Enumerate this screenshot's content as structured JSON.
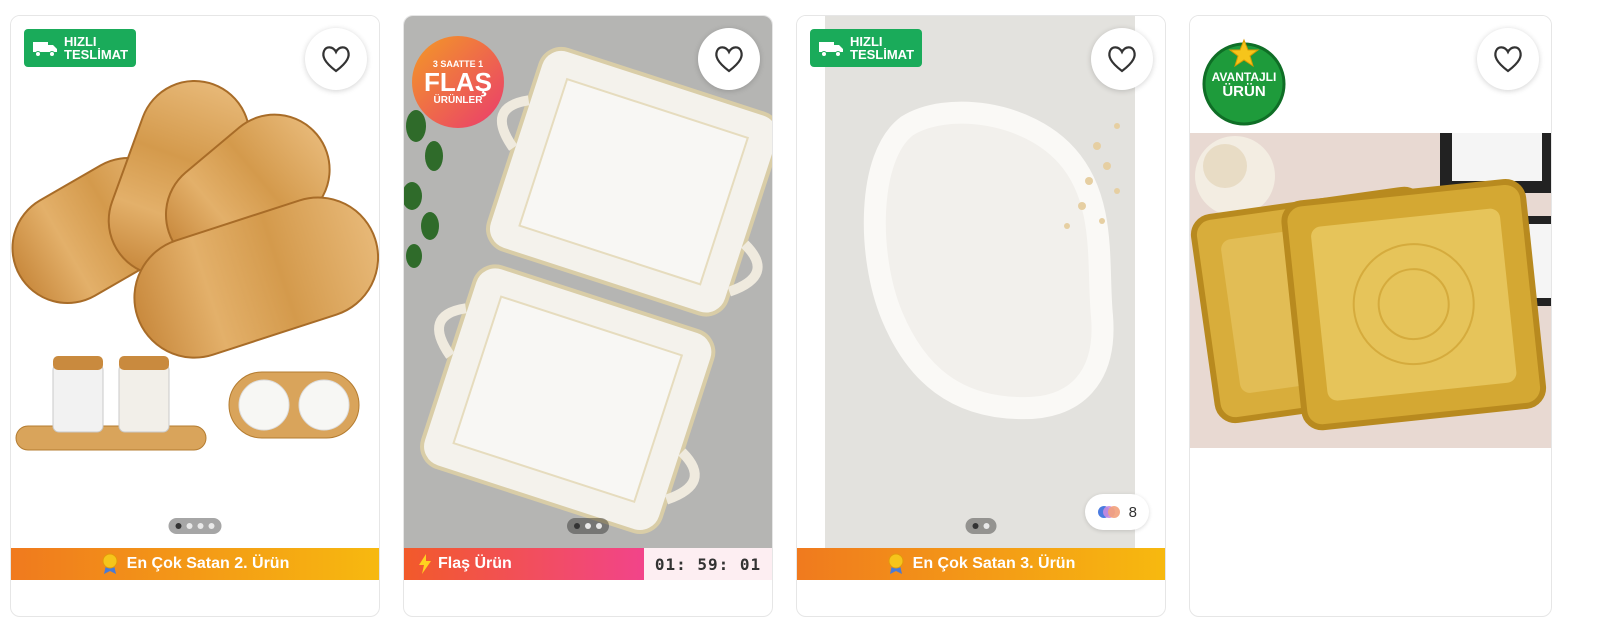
{
  "products": [
    {
      "badge_line1": "HIZLI",
      "badge_line2": "TESLİMAT",
      "bar_text": "En Çok Satan 2. Ürün"
    },
    {
      "flash_top": "3 SAATTE 1",
      "flash_main": "FLAŞ",
      "flash_bottom": "ÜRÜNLER",
      "bar_text": "Flaş Ürün",
      "timer": "01: 59: 01"
    },
    {
      "badge_line1": "HIZLI",
      "badge_line2": "TESLİMAT",
      "bar_text": "En Çok Satan 3. Ürün",
      "variant_count": "8"
    },
    {
      "adv_line1": "AVANTAJLI",
      "adv_line2": "ÜRÜN"
    }
  ],
  "colors": {
    "fast_badge": "#1aab5a",
    "best_seller_from": "#f07a1e",
    "best_seller_to": "#f7b90f",
    "flash_from": "#f25a2a",
    "flash_to": "#f2448a"
  }
}
